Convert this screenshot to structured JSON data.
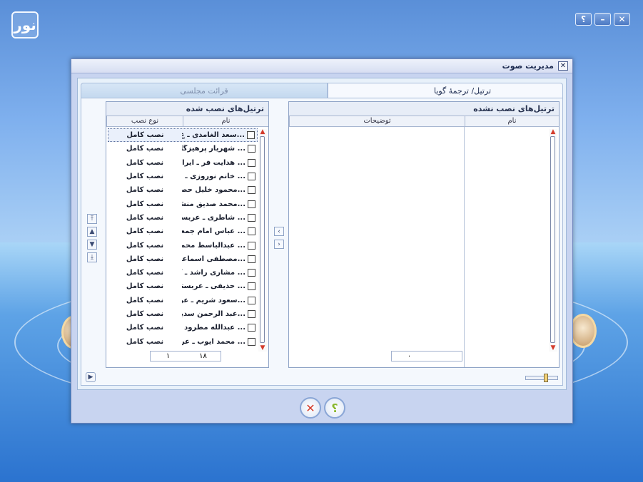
{
  "window": {
    "help_label": "؟",
    "minimize_label": "–",
    "close_label": "✕",
    "logo_text": "نور"
  },
  "dialog": {
    "title": "مدیریت صوت",
    "close_label": "✕",
    "tabs": [
      {
        "label": "ترتیل/ ترجمهٔ گویا",
        "active": true
      },
      {
        "label": "قرائت مجلسی",
        "active": false
      }
    ],
    "not_installed": {
      "caption": "ترتیل‌های نصب نشده",
      "col_name": "نام",
      "col_desc": "توضیحات",
      "rows": [],
      "count": "۰",
      "page": ""
    },
    "installed": {
      "caption": "ترتیل‌های نصب شده",
      "col_name": "نام",
      "col_type": "نوع نصب",
      "count": "۱۸",
      "page": "۱",
      "rows": [
        {
          "name": "سعد الغامدی ـ ع...",
          "type": "نصب کامل"
        },
        {
          "name": "شهریار پرهیزگار ...",
          "type": "نصب کامل"
        },
        {
          "name": "هدایت فر ـ ایران ...",
          "type": "نصب کامل"
        },
        {
          "name": "خانم نوروزی ـ ...",
          "type": "نصب کامل"
        },
        {
          "name": "محمود خلیل حصـ...",
          "type": "نصب کامل"
        },
        {
          "name": "محمد صدیق منشـ...",
          "type": "نصب کامل"
        },
        {
          "name": "شاطری ـ عربستا ...",
          "type": "نصب کامل"
        },
        {
          "name": "عباس امام جمعـ ...",
          "type": "نصب کامل"
        },
        {
          "name": "عبدالباسط محمد ...",
          "type": "نصب کامل"
        },
        {
          "name": "مصطفی اسماعـ...",
          "type": "نصب کامل"
        },
        {
          "name": "مشاری راشد ـ کـ ...",
          "type": "نصب کامل"
        },
        {
          "name": "حذیفی ـ عربستا ...",
          "type": "نصب کامل"
        },
        {
          "name": "سعود شریم ـ عرب...",
          "type": "نصب کامل"
        },
        {
          "name": "عبد الرحمن سدیـ...",
          "type": "نصب کامل"
        },
        {
          "name": "عبدالله مطرود ـ ...",
          "type": "نصب کامل"
        },
        {
          "name": "محمد ایوب ـ عر ...",
          "type": "نصب کامل"
        }
      ]
    },
    "ok_label": "؟",
    "cancel_label": "✕"
  },
  "colors": {
    "accent": "#4d7ac4",
    "cancel": "#d43c2c",
    "help": "#8ab830"
  }
}
